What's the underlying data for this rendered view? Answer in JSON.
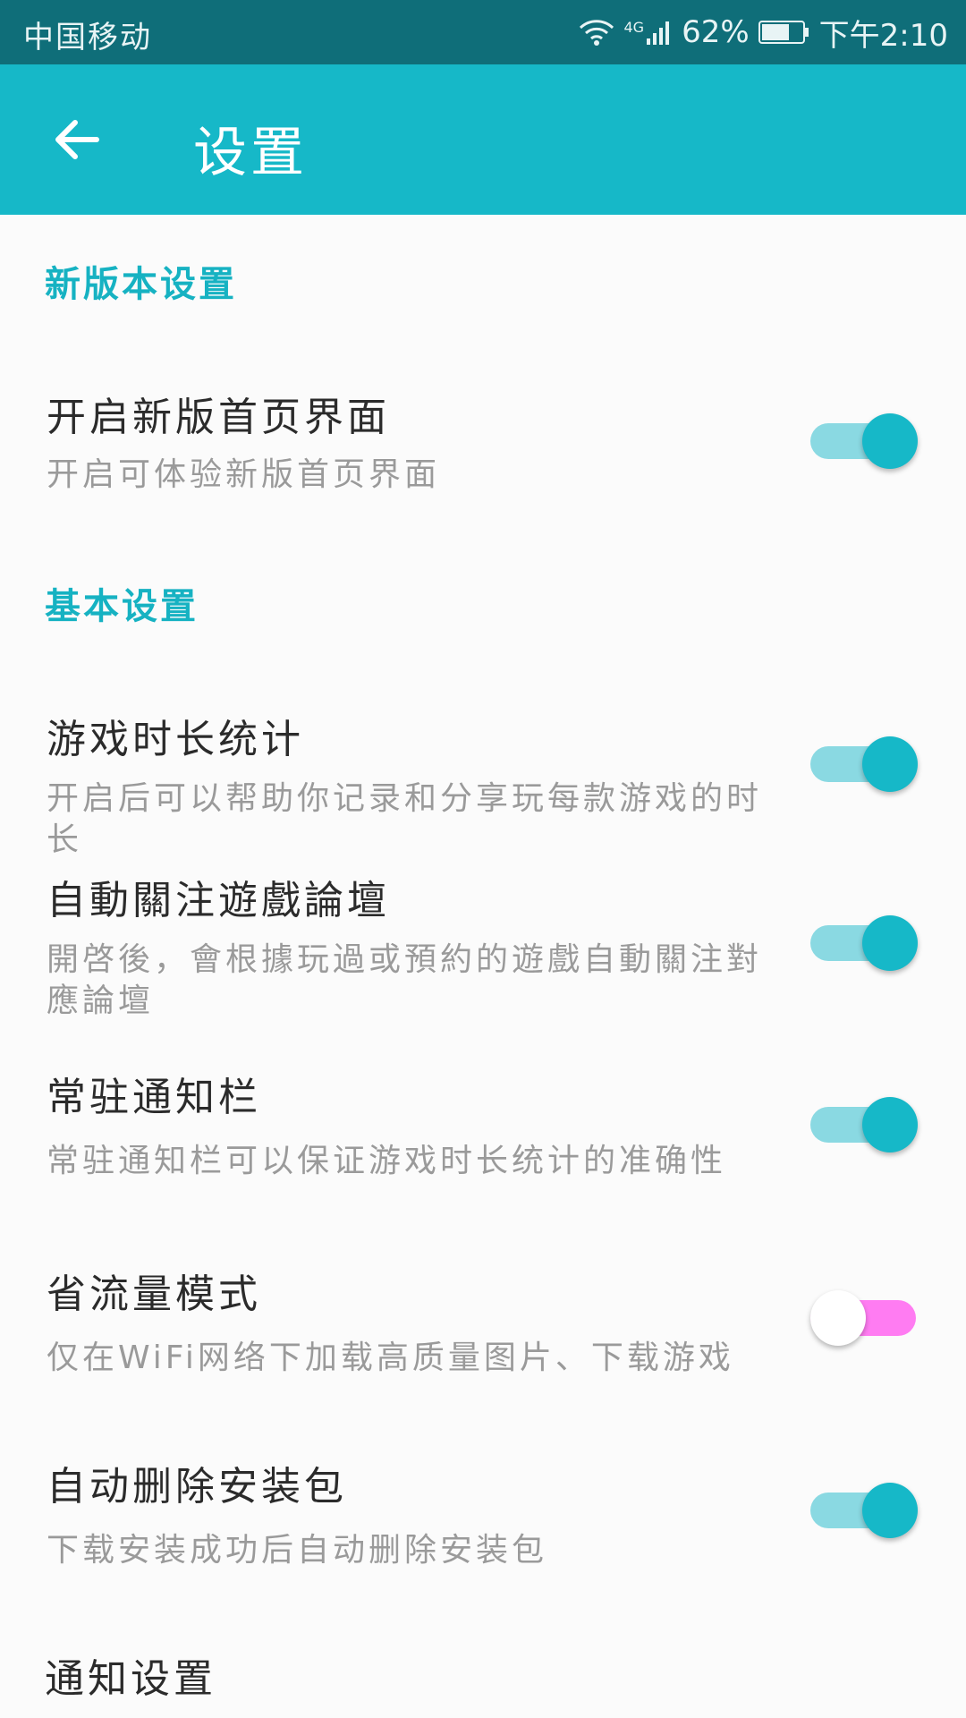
{
  "status_bar": {
    "carrier": "中国移动",
    "network": "4G",
    "battery": "62%",
    "time": "下午2:10"
  },
  "app_bar": {
    "title": "设置",
    "back_icon": "arrow-left-icon"
  },
  "sections": [
    {
      "header": "新版本设置",
      "items": [
        {
          "title": "开启新版首页界面",
          "subtitle": "开启可体验新版首页界面",
          "enabled": true
        }
      ]
    },
    {
      "header": "基本设置",
      "items": [
        {
          "title": "游戏时长统计",
          "subtitle": "开启后可以帮助你记录和分享玩每款游戏的时长",
          "enabled": true
        },
        {
          "title": "自動關注遊戲論壇",
          "subtitle": "開啓後，會根據玩過或預約的遊戲自動關注對應論壇",
          "enabled": true
        },
        {
          "title": "常驻通知栏",
          "subtitle": "常驻通知栏可以保证游戏时长统计的准确性",
          "enabled": true
        },
        {
          "title": "省流量模式",
          "subtitle": "仅在WiFi网络下加载高质量图片、下载游戏",
          "enabled": false
        },
        {
          "title": "自动删除安装包",
          "subtitle": "下载安装成功后自动删除安装包",
          "enabled": true
        }
      ]
    }
  ],
  "notification_settings": {
    "title": "通知设置"
  },
  "colors": {
    "status_bar": "#0f6e79",
    "app_bar": "#16b8c8",
    "accent": "#16b2c2",
    "switch_on_track": "#8ad9e2",
    "switch_off_track": "#ff7cf2"
  }
}
